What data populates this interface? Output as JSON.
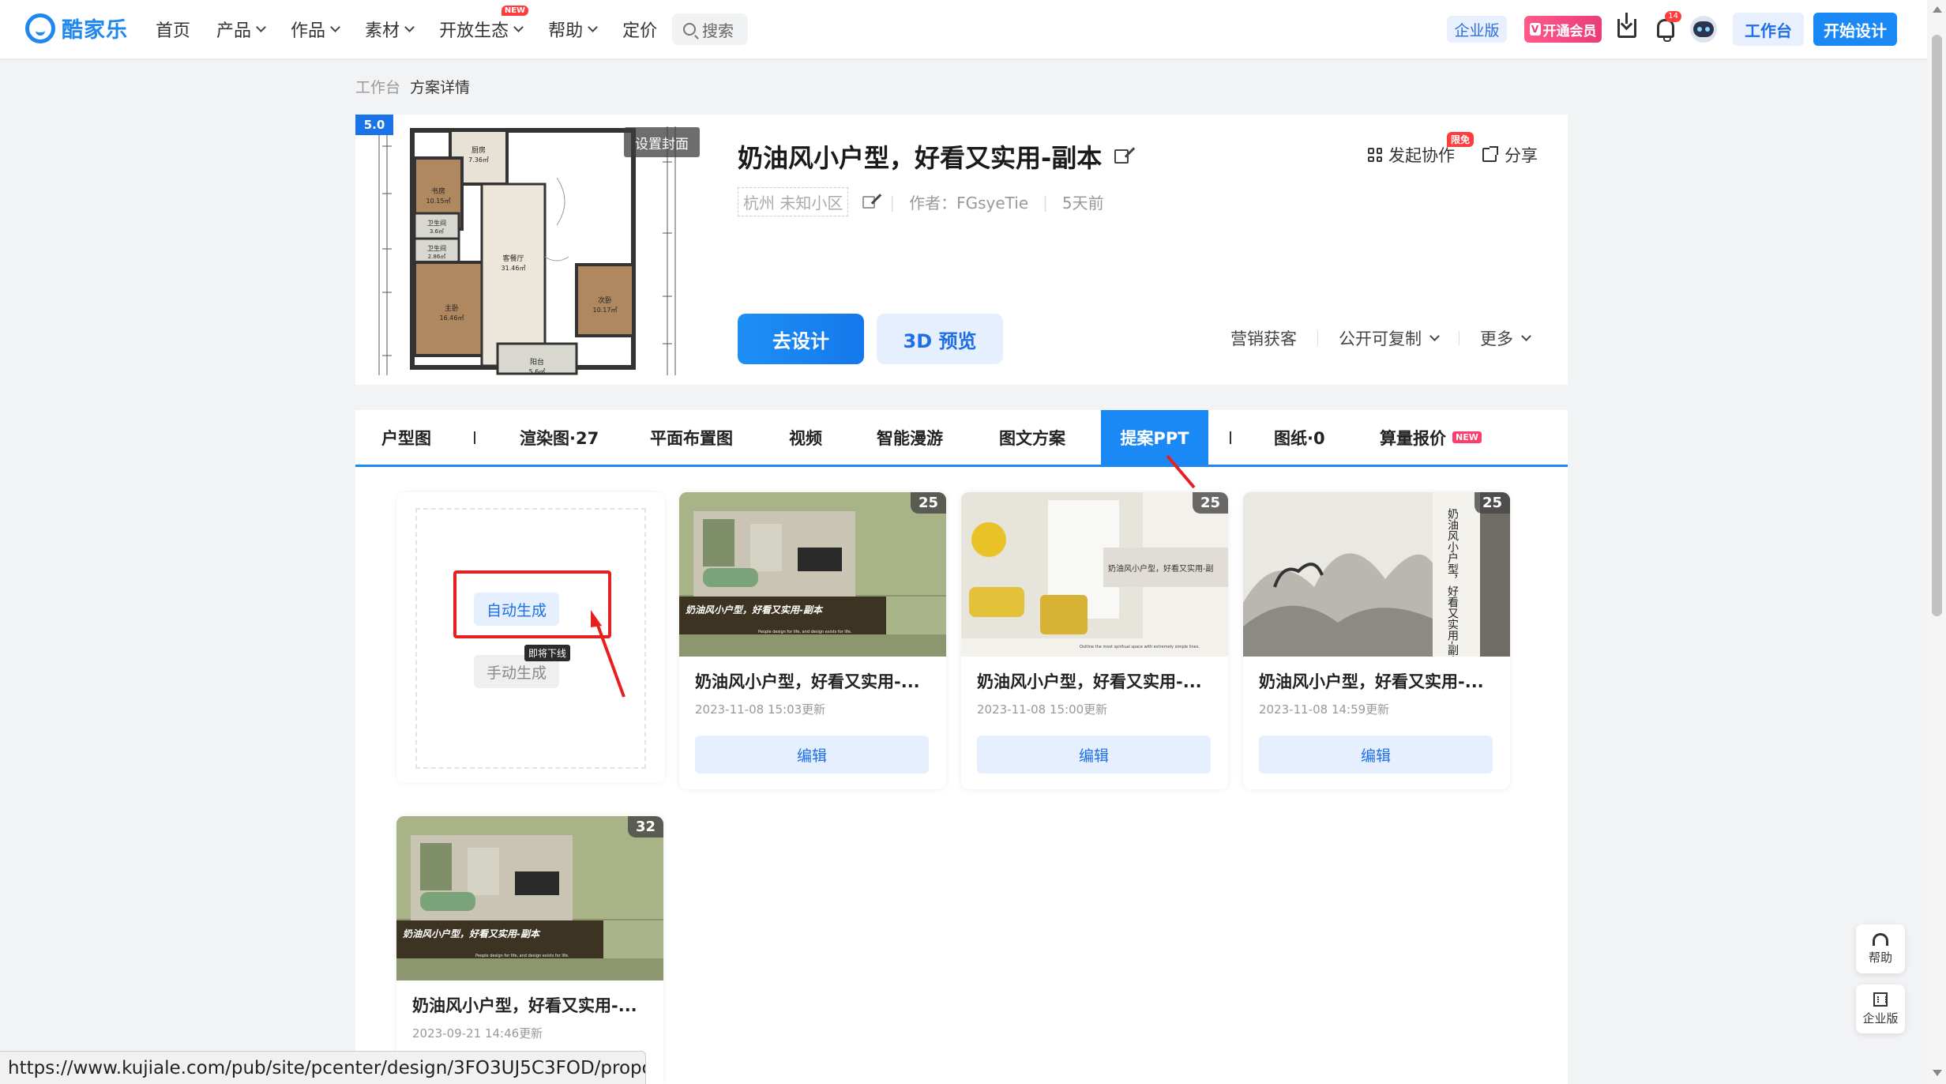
{
  "nav": {
    "logo_text": "酷家乐",
    "menu": [
      {
        "label": "首页",
        "dropdown": false
      },
      {
        "label": "产品",
        "dropdown": true
      },
      {
        "label": "作品",
        "dropdown": true
      },
      {
        "label": "素材",
        "dropdown": true
      },
      {
        "label": "开放生态",
        "dropdown": true,
        "badge": "NEW"
      },
      {
        "label": "帮助",
        "dropdown": true
      },
      {
        "label": "定价",
        "dropdown": false
      }
    ],
    "search_label": "搜索",
    "enterprise_label": "企业版",
    "vip_label": "开通会员",
    "vip_icon": "V",
    "notification_count": "14",
    "workbench_label": "工作台",
    "start_design_label": "开始设计",
    "accent_color": "#1a88f5"
  },
  "breadcrumb": {
    "root": "工作台",
    "current": "方案详情"
  },
  "plan": {
    "score": "5.0",
    "set_cover_label": "设置封面",
    "title": "奶油风小户型，好看又实用-副本",
    "location": "杭州 未知小区",
    "author": "作者：FGsyeTie",
    "updated": "5天前",
    "collab_label": "发起协作",
    "collab_badge": "限免",
    "share_label": "分享",
    "design_button": "去设计",
    "preview_button": "3D 预览",
    "actions": [
      "营销获客",
      "公开可复制",
      "更多"
    ],
    "floorplan_rooms": [
      {
        "name": "厨房",
        "area": "7.36㎡"
      },
      {
        "name": "书房",
        "area": "10.15㎡"
      },
      {
        "name": "卫生间",
        "area": "3.6㎡"
      },
      {
        "name": "卫生间",
        "area": "2.86㎡"
      },
      {
        "name": "客餐厅",
        "area": "31.46㎡"
      },
      {
        "name": "主卧",
        "area": "16.46㎡"
      },
      {
        "name": "次卧",
        "area": "10.17㎡"
      },
      {
        "name": "阳台",
        "area": "5.6㎡"
      }
    ]
  },
  "tabs": [
    {
      "label": "户型图"
    },
    {
      "label": "渲染图·27"
    },
    {
      "label": "平面布置图"
    },
    {
      "label": "视频"
    },
    {
      "label": "智能漫游"
    },
    {
      "label": "图文方案"
    },
    {
      "label": "提案PPT",
      "active": true
    },
    {
      "label": "图纸·0"
    },
    {
      "label": "算量报价",
      "badge": "NEW"
    }
  ],
  "generator": {
    "auto_label": "自动生成",
    "manual_label": "手动生成",
    "soon_label": "即将下线"
  },
  "ppts": [
    {
      "pages": "25",
      "title": "奶油风小户型，好看又实用-...",
      "date": "2023-11-08 15:03更新",
      "edit": "编辑",
      "slide_text": "奶油风小户型，好看又实用-副本",
      "slide_sub": "People design for life, and design exists for life."
    },
    {
      "pages": "25",
      "title": "奶油风小户型，好看又实用-...",
      "date": "2023-11-08 15:00更新",
      "edit": "编辑",
      "slide_text": "奶油风小户型，好看又实用-副",
      "slide_sub": "Outline the most spiritual space with extremely simple lines."
    },
    {
      "pages": "25",
      "title": "奶油风小户型，好看又实用-...",
      "date": "2023-11-08 14:59更新",
      "edit": "编辑",
      "slide_text": "奶油风小户型，好看又实用-副本，好"
    },
    {
      "pages": "32",
      "title": "奶油风小户型，好看又实用-...",
      "date": "2023-09-21 14:46更新",
      "slide_text": "奶油风小户型，好看又实用-副本",
      "slide_sub": "People design for life, and design exists for life."
    }
  ],
  "float": {
    "help_label": "帮助",
    "enterprise_label": "企业版"
  },
  "status_url": "https://www.kujiale.com/pub/site/pcenter/design/3FO3UJ5C3FOD/propo..."
}
